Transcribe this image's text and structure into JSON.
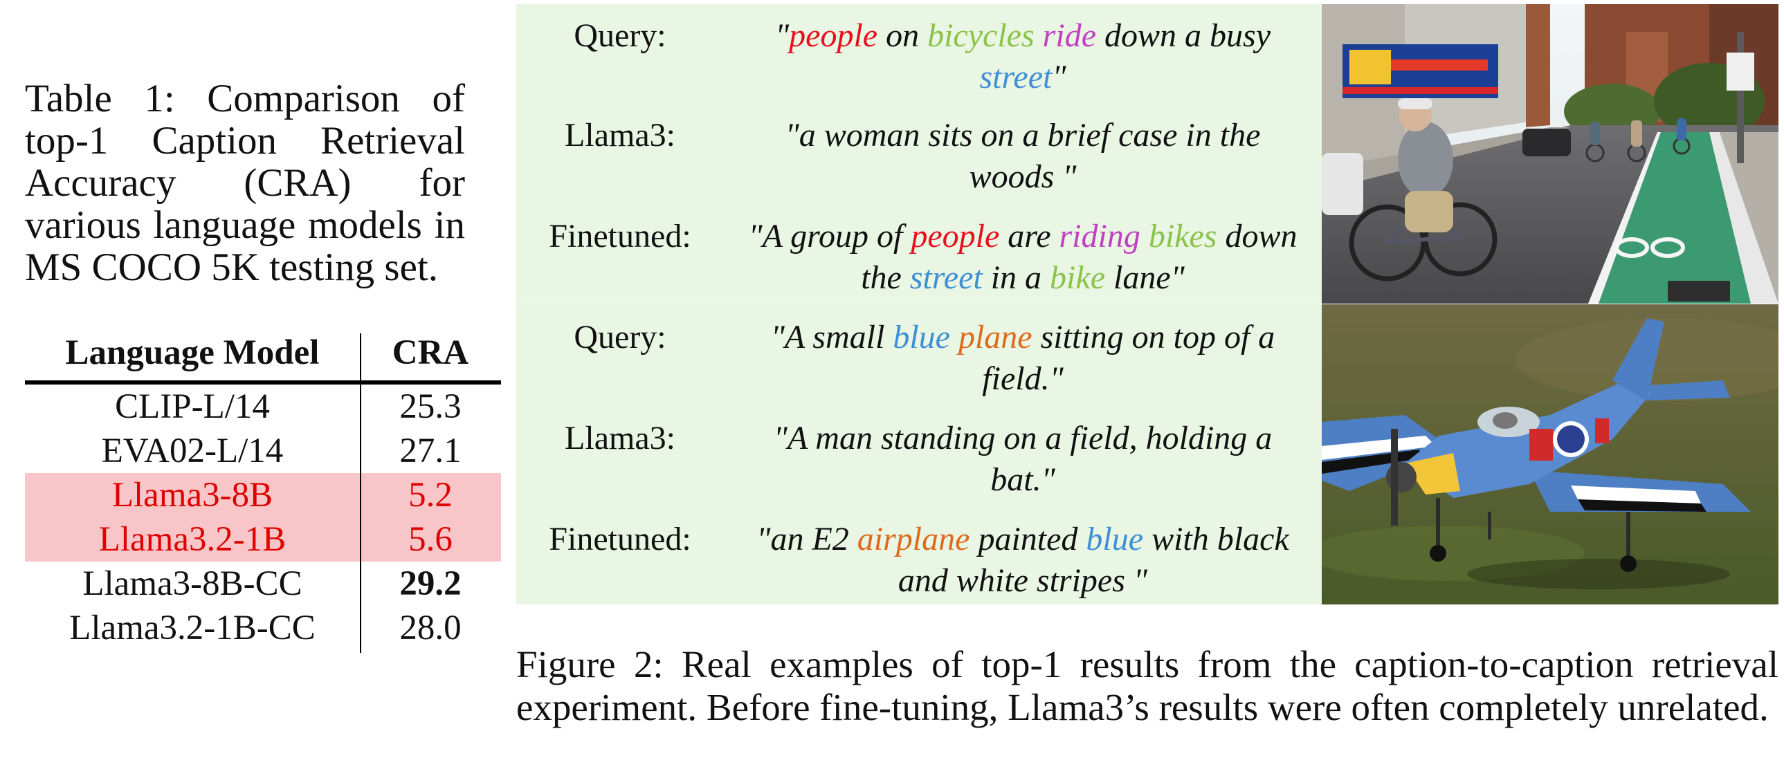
{
  "table": {
    "caption": "Table 1: Comparison of top-1 Caption Retrieval Accuracy (CRA) for various language models in MS COCO 5K testing set.",
    "headers": {
      "model": "Language Model",
      "cra": "CRA"
    },
    "rows": [
      {
        "model": "CLIP-L/14",
        "cra": "25.3"
      },
      {
        "model": "EVA02-L/14",
        "cra": "27.1"
      },
      {
        "model": "Llama3-8B",
        "cra": "5.2"
      },
      {
        "model": "Llama3.2-1B",
        "cra": "5.6"
      },
      {
        "model": "Llama3-8B-CC",
        "cra": "29.2"
      },
      {
        "model": "Llama3.2-1B-CC",
        "cra": "28.0"
      }
    ],
    "highlight_color": "#f8c6c8",
    "highlight_text_color": "#e00000"
  },
  "figure": {
    "panel_color": "#e9f6e4",
    "labels": {
      "query": "Query:",
      "llama": "Llama3:",
      "finetuned": "Finetuned:"
    },
    "examples": [
      {
        "query_l1": [
          "\"",
          "people",
          " on ",
          "bicycles",
          " ",
          "ride",
          " down a busy"
        ],
        "query_l2": [
          "street",
          "\""
        ],
        "llama_l1": "\"a woman sits on a brief case in the",
        "llama_l2": "woods \"",
        "ft_l1": [
          "\"A group of ",
          "people",
          " are ",
          "riding",
          " ",
          "bikes",
          " down"
        ],
        "ft_l2": [
          "the ",
          "street",
          " in a ",
          "bike",
          " lane\""
        ]
      },
      {
        "query_l1": [
          "\"A small ",
          "blue",
          " ",
          "plane",
          " sitting on top of a"
        ],
        "query_l2": "field.\"",
        "llama_l1": "\"A man standing on a field, holding a",
        "llama_l2": "bat.\"",
        "ft_l1": [
          "\"an E2 ",
          "airplane",
          " painted ",
          "blue",
          " with black"
        ],
        "ft_l2": "and white stripes \""
      }
    ],
    "colors": {
      "red": "#e8101e",
      "green": "#8bc34a",
      "purple": "#c23fc2",
      "blue": "#3f8fd6",
      "orange": "#e06a1b"
    },
    "caption": "Figure 2: Real examples of top-1 results from the caption-to-caption retrieval experiment. Before fine-tuning, Llama3’s results were often completely unrelated."
  }
}
